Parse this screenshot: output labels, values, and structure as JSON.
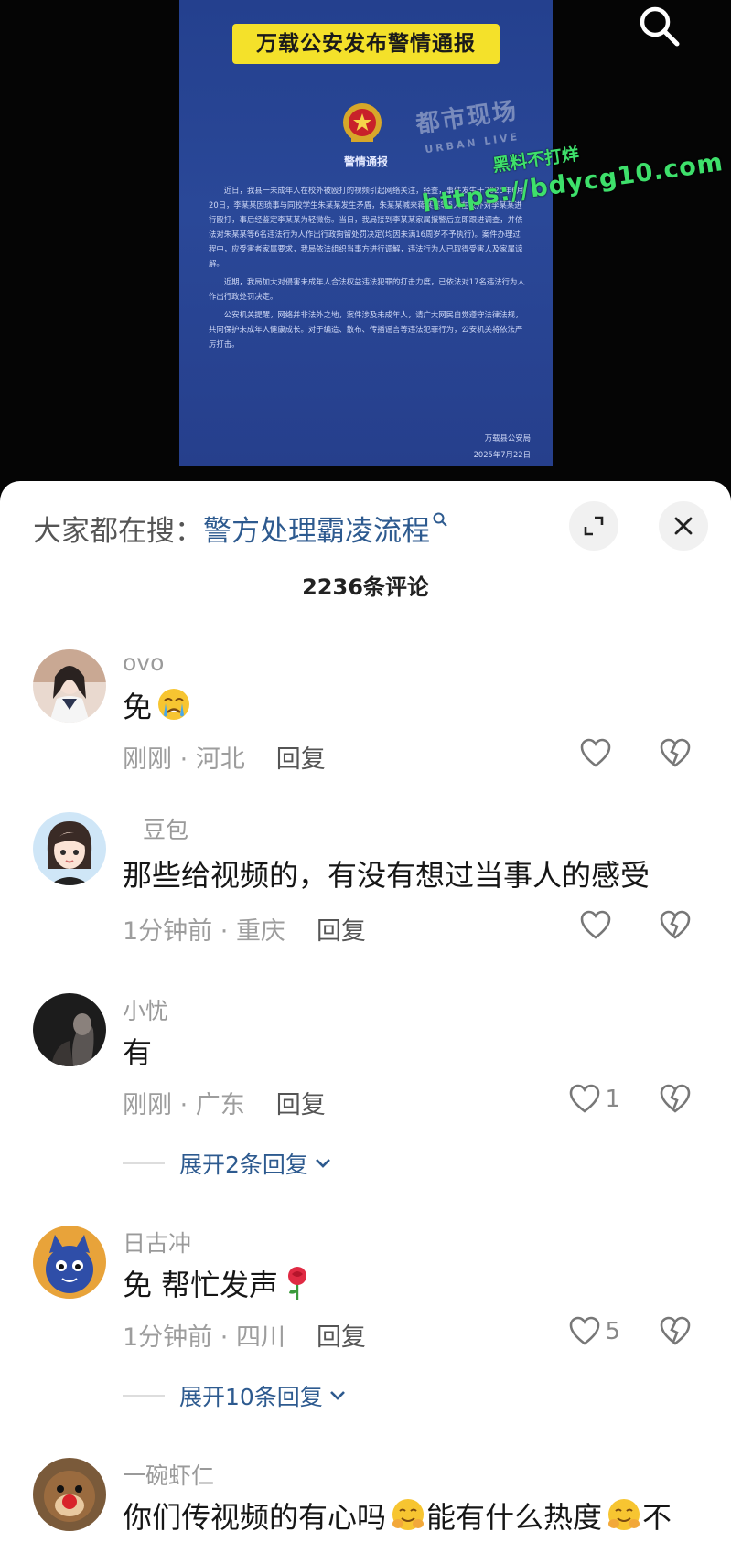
{
  "video": {
    "banner_title": "万载公安发布警情通报",
    "notice_heading": "警情通报",
    "notice_paragraphs": [
      "近日，我县一未成年人在校外被殴打的视频引起网络关注，经查，事件发生于2025年6月20日，李某某因琐事与同校学生朱某某发生矛盾，朱某某喊来蒋某某等5人在校外对李某某进行殴打，事后经鉴定李某某为轻微伤。当日，我局接到李某某家属报警后立即跟进调查，并依法对朱某某等6名违法行为人作出行政拘留处罚决定(均因未满16周岁不予执行)。案件办理过程中，应受害者家属要求，我局依法组织当事方进行调解，违法行为人已取得受害人及家属谅解。",
      "近期，我局加大对侵害未成年人合法权益违法犯罪的打击力度，已依法对17名违法行为人作出行政处罚决定。",
      "公安机关提醒，网络并非法外之地，案件涉及未成年人，请广大网民自觉遵守法律法规，共同保护未成年人健康成长。对于编造、散布、传播谣言等违法犯罪行为，公安机关将依法严厉打击。"
    ],
    "notice_signature": "万载县公安局",
    "notice_date": "2025年7月22日",
    "logo_mark": "都市现场",
    "logo_sub": "URBAN LIVE",
    "watermark_line1": "黑料不打烊",
    "watermark_line2": "https://bdycg10.com"
  },
  "sheet": {
    "suggest_prefix": "大家都在搜：",
    "suggest_term": "警方处理霸凌流程",
    "comment_count": "2236条评论"
  },
  "comments": [
    {
      "user": "ovo",
      "text": "免",
      "time": "刚刚",
      "region": "河北",
      "reply_label": "回复",
      "likes": ""
    },
    {
      "user": "豆包",
      "text": "那些给视频的，有没有想过当事人的感受",
      "time": "1分钟前",
      "region": "重庆",
      "reply_label": "回复",
      "likes": ""
    },
    {
      "user": "小忧",
      "text": "有",
      "time": "刚刚",
      "region": "广东",
      "reply_label": "回复",
      "likes": "1",
      "expand": "展开2条回复"
    },
    {
      "user": "日古冲",
      "text": "免 帮忙发声",
      "time": "1分钟前",
      "region": "四川",
      "reply_label": "回复",
      "likes": "5",
      "expand": "展开10条回复"
    },
    {
      "user": "一碗虾仁",
      "text": "你们传视频的有心吗",
      "text2": "能有什么热度",
      "text3": "不"
    }
  ],
  "meta_sep": " · ",
  "icons": {
    "search": "search-icon",
    "expand": "expand-icon",
    "close": "close-icon",
    "like": "heart-icon",
    "dislike": "broken-heart-icon",
    "chevron": "chevron-down-icon",
    "emoji_crying": "crying-face-emoji",
    "emoji_rose": "rose-emoji",
    "emoji_hug": "hugging-face-emoji"
  },
  "colors": {
    "link_blue": "#2d5a8f",
    "notice_blue": "#2a4898",
    "banner_yellow": "#f4e12a",
    "watermark_green": "#3ee06b"
  }
}
